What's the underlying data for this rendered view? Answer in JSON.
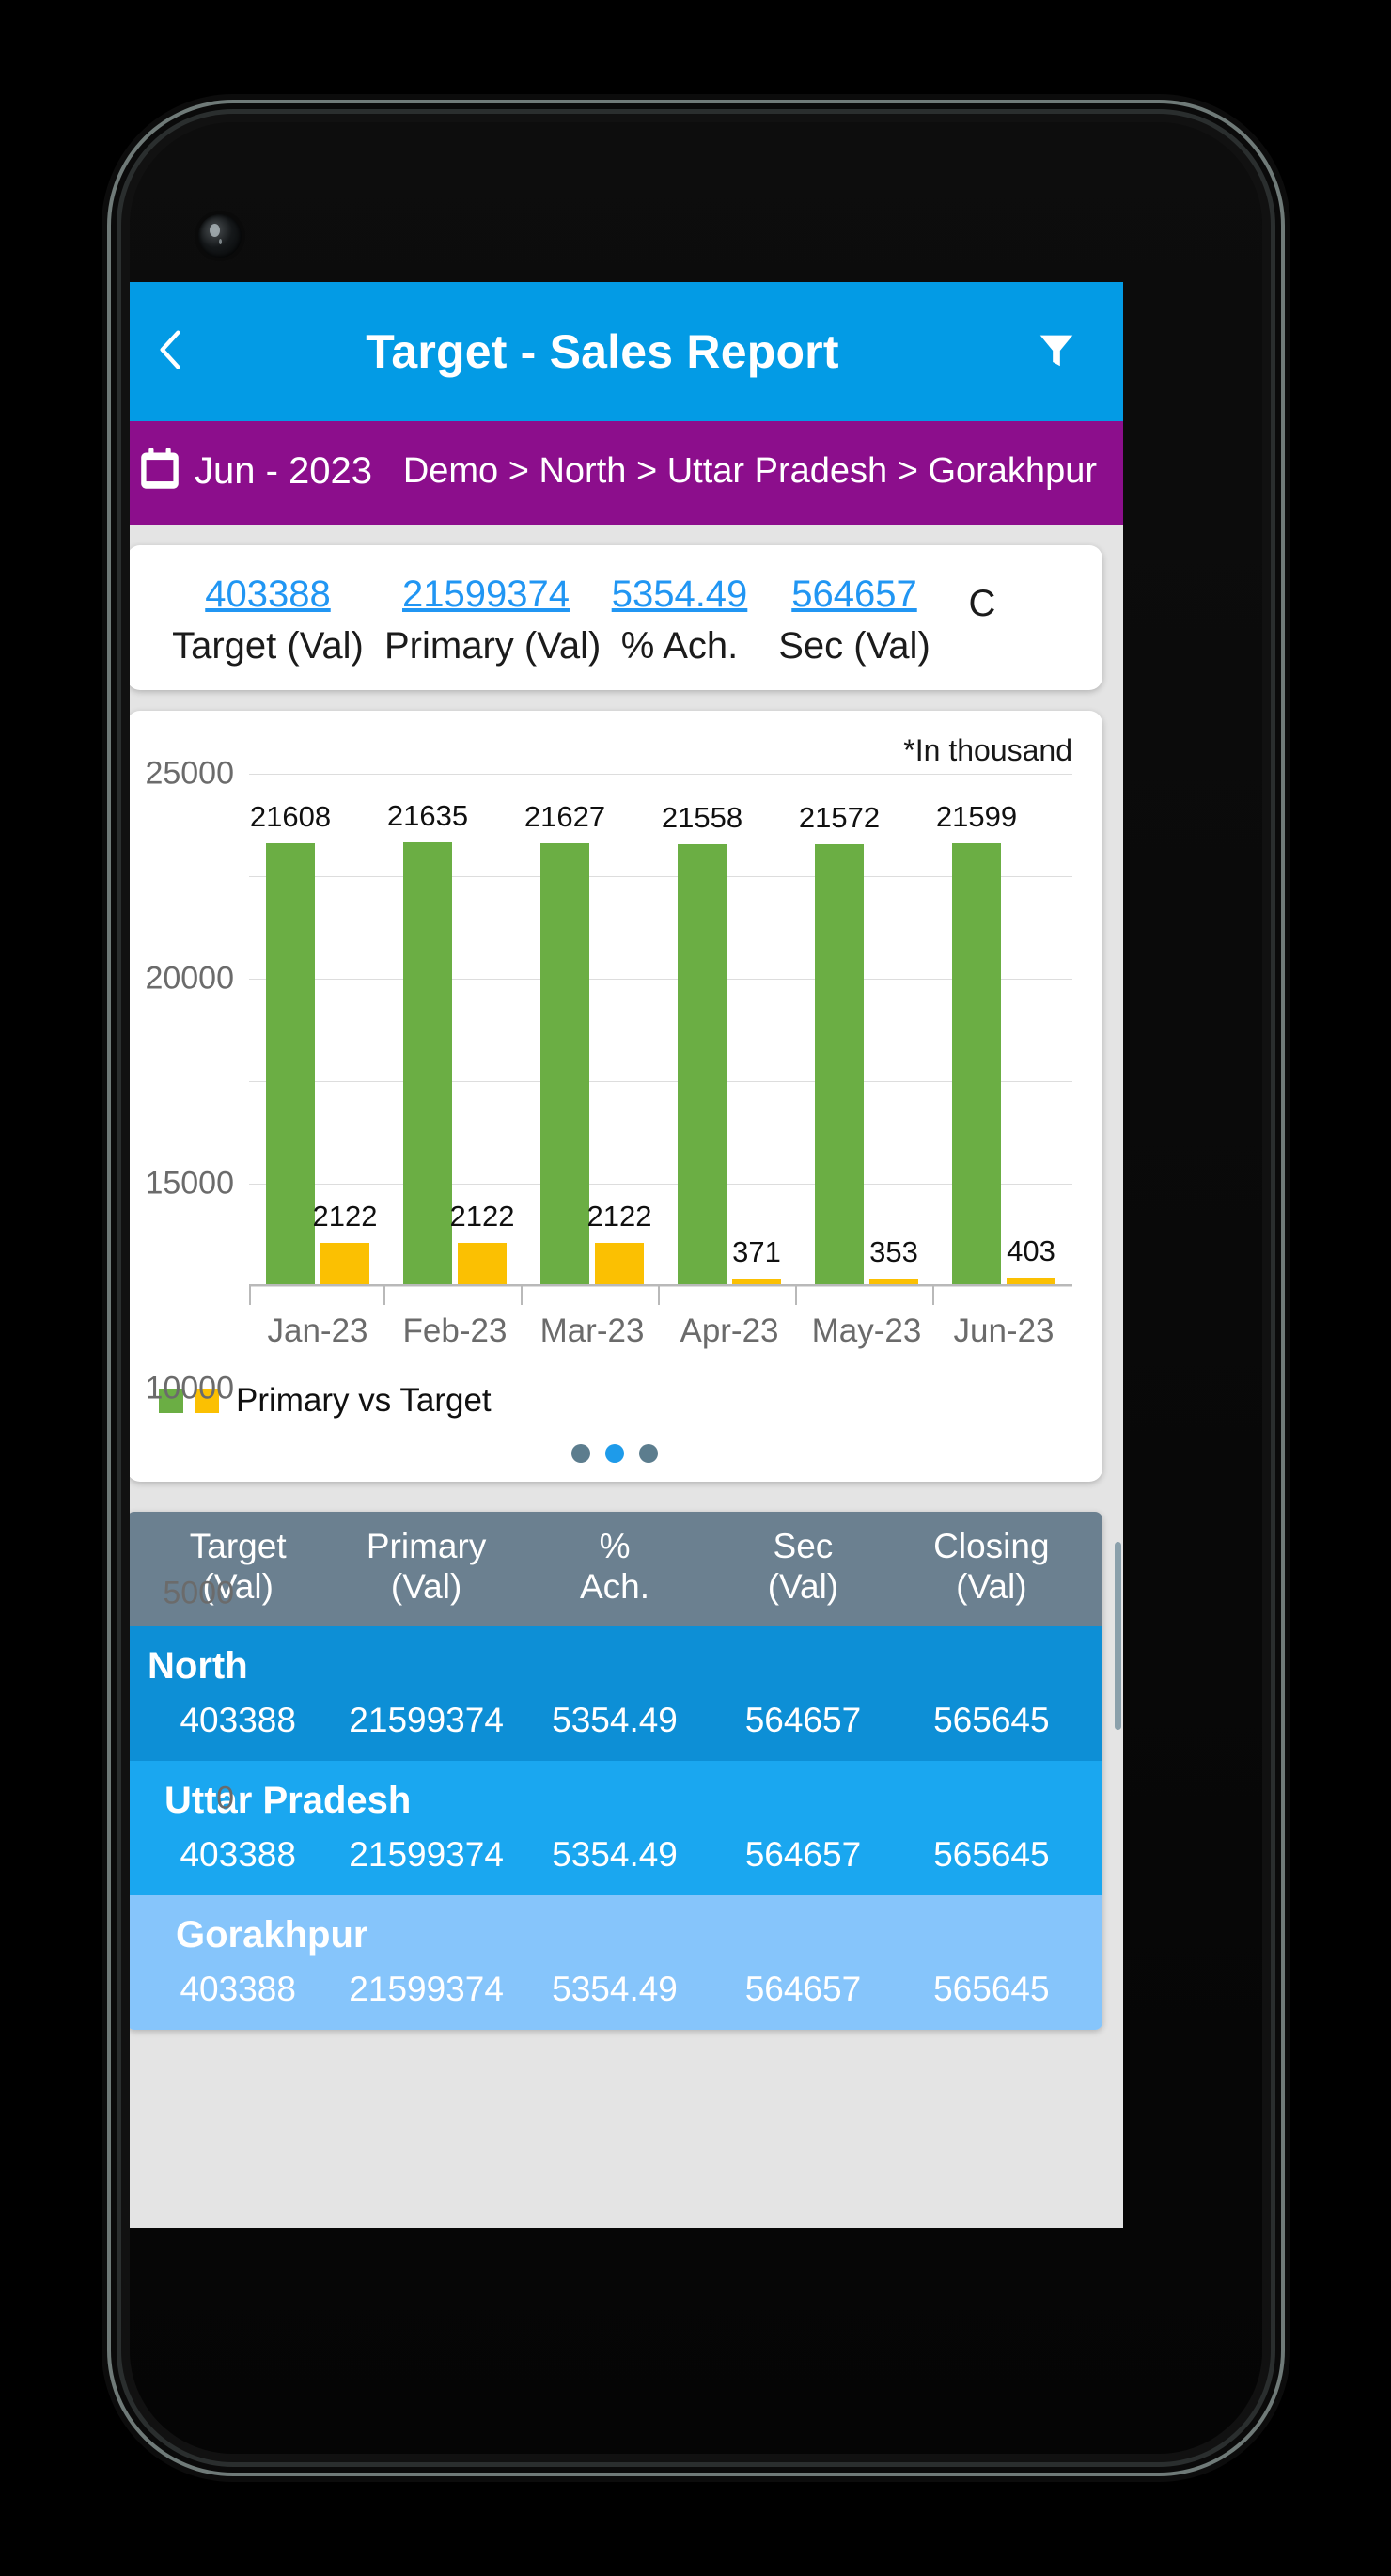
{
  "app": {
    "title": "Target - Sales Report",
    "back_icon": "chevron-left-icon",
    "filter_icon": "funnel-filter-icon",
    "header_color": "#039BE5"
  },
  "context": {
    "calendar_icon": "calendar-icon",
    "period": "Jun - 2023",
    "breadcrumb": "Demo > North > Uttar Pradesh > Gorakhpur",
    "bar_color": "#8C0E8C"
  },
  "kpis": [
    {
      "value": "403388",
      "label": "Target (Val)"
    },
    {
      "value": "21599374",
      "label": "Primary (Val)"
    },
    {
      "value": "5354.49",
      "label": "% Ach."
    },
    {
      "value": "564657",
      "label": "Sec (Val)"
    },
    {
      "value": "",
      "label": "C"
    }
  ],
  "chart_card": {
    "note": "*In thousand",
    "legend_label": "Primary vs Target",
    "dots": [
      {
        "active": false
      },
      {
        "active": true
      },
      {
        "active": false
      }
    ]
  },
  "chart_data": {
    "type": "bar",
    "title": "",
    "subtitle": "*In thousand",
    "categories": [
      "Jan-23",
      "Feb-23",
      "Mar-23",
      "Apr-23",
      "May-23",
      "Jun-23"
    ],
    "series": [
      {
        "name": "Primary",
        "color": "#6BAE44",
        "values": [
          21608,
          21635,
          21627,
          21558,
          21572,
          21599
        ]
      },
      {
        "name": "Target",
        "color": "#FBC002",
        "values": [
          2122,
          2122,
          2122,
          371,
          353,
          403
        ]
      }
    ],
    "legend": [
      "Primary vs Target"
    ],
    "legend_position": "bottom-left",
    "xlabel": "",
    "ylabel": "",
    "ylim": [
      0,
      25000
    ],
    "yticks": [
      0,
      5000,
      10000,
      15000,
      20000,
      25000
    ],
    "ytick_labels": [
      "0",
      "5000",
      "10000",
      "15000",
      "20000",
      "25000"
    ],
    "grid": true,
    "data_labels": true
  },
  "table": {
    "headers": [
      "Target\n(Val)",
      "Primary\n(Val)",
      "%\nAch.",
      "Sec\n(Val)",
      "Closing\n(Val)"
    ],
    "header_lines": [
      [
        "Target",
        "(Val)"
      ],
      [
        "Primary",
        "(Val)"
      ],
      [
        "%",
        "Ach."
      ],
      [
        "Sec",
        "(Val)"
      ],
      [
        "Closing",
        "(Val)"
      ]
    ],
    "rows": [
      {
        "name": "North",
        "level": 0,
        "values": [
          "403388",
          "21599374",
          "5354.49",
          "564657",
          "565645"
        ]
      },
      {
        "name": "Uttar Pradesh",
        "level": 1,
        "values": [
          "403388",
          "21599374",
          "5354.49",
          "564657",
          "565645"
        ]
      },
      {
        "name": "Gorakhpur",
        "level": 2,
        "values": [
          "403388",
          "21599374",
          "5354.49",
          "564657",
          "565645"
        ]
      }
    ]
  }
}
